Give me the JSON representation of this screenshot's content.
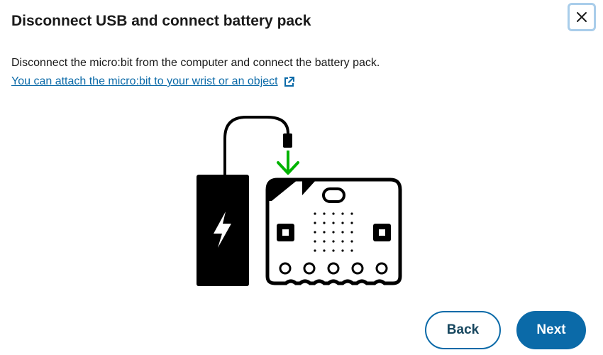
{
  "dialog": {
    "title": "Disconnect USB and connect battery pack",
    "close_icon": "close-icon",
    "body": "Disconnect the micro:bit from the computer and connect the battery pack.",
    "link": {
      "text": "You can attach the micro:bit to your wrist or an object",
      "icon": "external-link-icon"
    },
    "illustration": {
      "parts": [
        "battery-pack-icon",
        "lightning-bolt-icon",
        "usb-cable",
        "green-arrow-down-icon",
        "microbit-board"
      ]
    },
    "buttons": {
      "back": "Back",
      "next": "Next"
    }
  },
  "colors": {
    "accent": "#0b6aa8",
    "link": "#0b6aa8",
    "arrow": "#00b300",
    "close_border": "#a9cdea",
    "back_text": "#17475f"
  }
}
